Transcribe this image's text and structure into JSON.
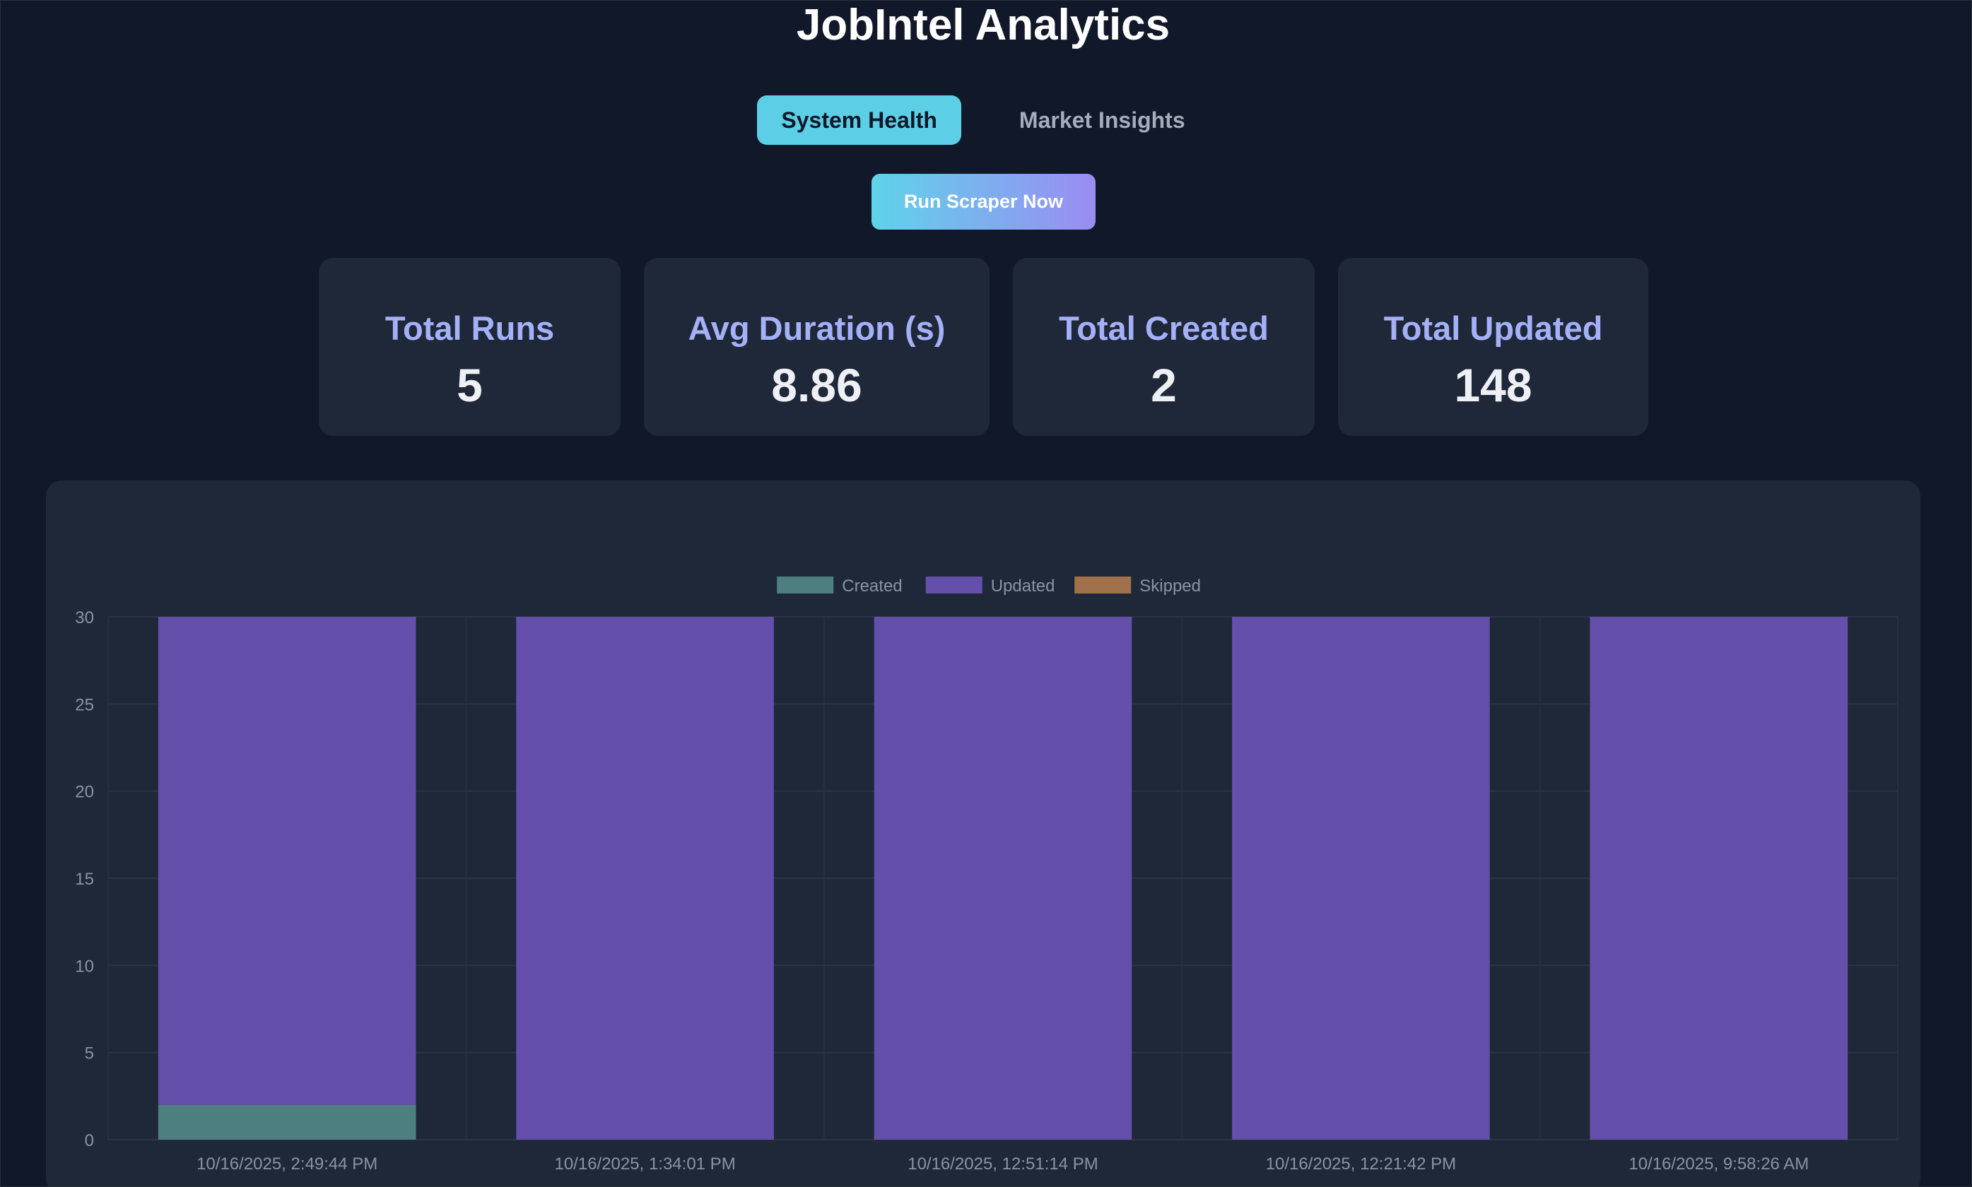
{
  "header": {
    "title": "JobIntel Analytics"
  },
  "tabs": [
    {
      "label": "System Health",
      "active": true
    },
    {
      "label": "Market Insights",
      "active": false
    }
  ],
  "actions": {
    "run_scraper_label": "Run Scraper Now"
  },
  "stats": [
    {
      "label": "Total Runs",
      "value": "5"
    },
    {
      "label": "Avg Duration (s)",
      "value": "8.86"
    },
    {
      "label": "Total Created",
      "value": "2"
    },
    {
      "label": "Total Updated",
      "value": "148"
    }
  ],
  "colors": {
    "background": "#101829",
    "card": "#1f2838",
    "accent": "#5ccfe6",
    "stat_label": "#a4b0f8",
    "created": "#4e7f80",
    "updated": "#644faa",
    "skipped": "#a0714a"
  },
  "chart_data": {
    "type": "bar",
    "stacked": true,
    "categories": [
      "10/16/2025, 2:49:44 PM",
      "10/16/2025, 1:34:01 PM",
      "10/16/2025, 12:51:14 PM",
      "10/16/2025, 12:21:42 PM",
      "10/16/2025, 9:58:26 AM"
    ],
    "series": [
      {
        "name": "Created",
        "color": "#4e7f80",
        "values": [
          2,
          0,
          0,
          0,
          0
        ]
      },
      {
        "name": "Updated",
        "color": "#644faa",
        "values": [
          28,
          30,
          30,
          30,
          30
        ]
      },
      {
        "name": "Skipped",
        "color": "#a0714a",
        "values": [
          0,
          0,
          0,
          0,
          0
        ]
      }
    ],
    "ylim": [
      0,
      30
    ],
    "yticks": [
      0,
      5,
      10,
      15,
      20,
      25,
      30
    ],
    "grid": true,
    "legend_position": "top"
  }
}
